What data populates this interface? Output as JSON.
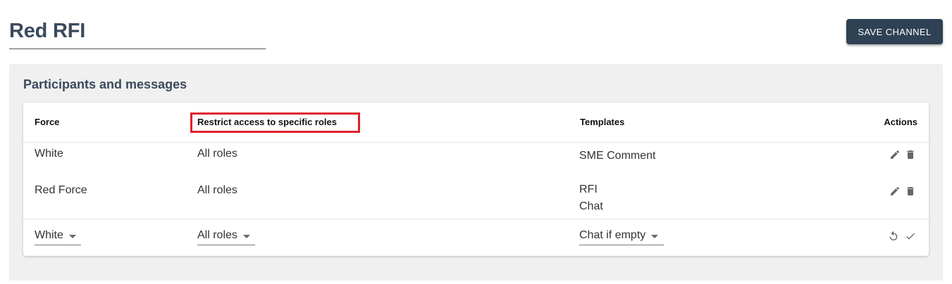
{
  "header": {
    "title": "Red RFI",
    "save_label": "SAVE CHANNEL"
  },
  "panel": {
    "title": "Participants and messages"
  },
  "table": {
    "columns": {
      "force": "Force",
      "roles": "Restrict access to specific roles",
      "templates": "Templates",
      "actions": "Actions"
    },
    "rows": [
      {
        "force": "White",
        "roles": "All roles",
        "templates": [
          "SME Comment"
        ]
      },
      {
        "force": "Red Force",
        "roles": "All roles",
        "templates": [
          "RFI",
          "Chat"
        ]
      }
    ],
    "new_row": {
      "force": "White",
      "roles": "All roles",
      "templates": "Chat if empty"
    }
  },
  "colors": {
    "button_bg": "#2f4154",
    "title": "#3b4a5c",
    "highlight": "#e0202a",
    "panel_bg": "#f0f0f0"
  },
  "icons": [
    "pencil-icon",
    "trash-icon",
    "undo-icon",
    "check-icon",
    "chevron-down-icon"
  ]
}
